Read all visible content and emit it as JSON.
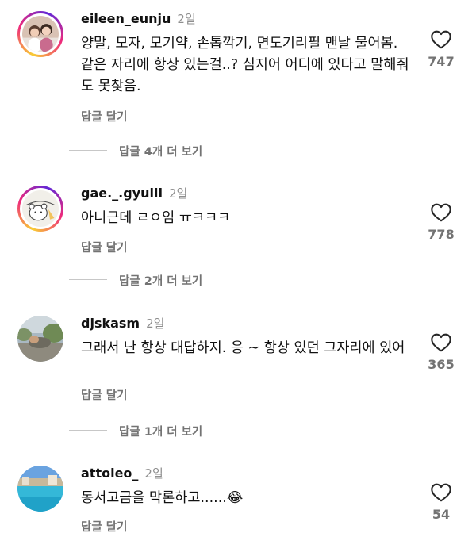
{
  "comments": [
    {
      "username": "eileen_eunju",
      "time": "2일",
      "text": "양말, 모자, 모기약, 손톱깍기, 면도기리필 맨날 물어봄. 같은 자리에 항상 있는걸..? 심지어 어디에 있다고 말해줘도 못찾음.",
      "reply_label": "답글 달기",
      "likes": "747",
      "more_replies": "답글 4개 더 보기"
    },
    {
      "username": "gae._.gyulii",
      "time": "2일",
      "text": "아니근데 ㄹㅇ임 ㅠㅋㅋㅋ",
      "reply_label": "답글 달기",
      "likes": "778",
      "more_replies": "답글 2개 더 보기"
    },
    {
      "username": "djskasm",
      "time": "2일",
      "text": "그래서 난 항상 대답하지. 응 ~ 항상 있던 그자리에 있어",
      "reply_label": "답글 달기",
      "likes": "365",
      "more_replies": "답글 1개 더 보기"
    },
    {
      "username": "attoleo_",
      "time": "2일",
      "text": "동서고금을 막론하고......😂",
      "reply_label": "답글 달기",
      "likes": "54"
    }
  ],
  "icons": {
    "like": "heart-outline-icon"
  },
  "colors": {
    "secondary_text": "#737373",
    "timestamp": "#8e8e8e"
  }
}
